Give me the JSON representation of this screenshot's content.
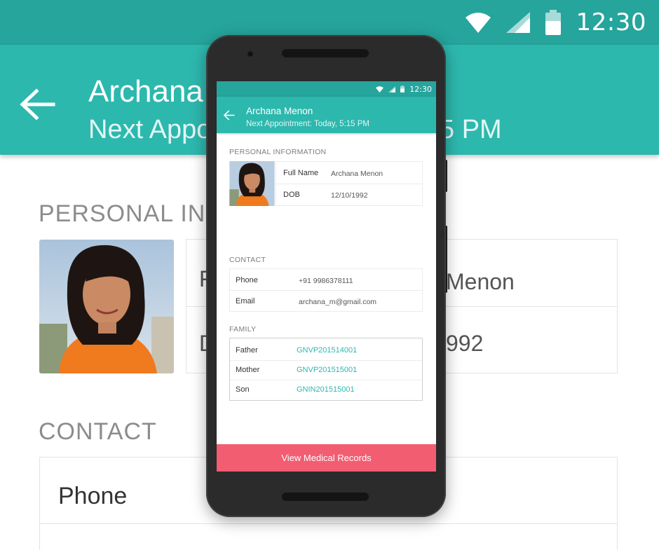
{
  "background": {
    "status_time": "12:30",
    "title_visible": "Archana",
    "subtitle_visible": "Next Appo",
    "subtitle_tail": "5 PM",
    "section_personal": "PERSONAL INFO",
    "card_name_tail": "Menon",
    "card_dob_tail": "992",
    "card_letter_f": "F",
    "card_letter_d": "D",
    "section_contact": "CONTACT",
    "contact_phone_label": "Phone"
  },
  "phone": {
    "status_time": "12:30",
    "title": "Archana Menon",
    "subtitle": "Next Appointment: Today, 5:15 PM",
    "personal": {
      "heading": "PERSONAL INFORMATION",
      "rows": [
        {
          "label": "Full Name",
          "value": "Archana Menon"
        },
        {
          "label": "DOB",
          "value": "12/10/1992"
        }
      ]
    },
    "contact": {
      "heading": "CONTACT",
      "rows": [
        {
          "label": "Phone",
          "value": "+91 9986378111"
        },
        {
          "label": "Email",
          "value": "archana_m@gmail.com"
        }
      ]
    },
    "family": {
      "heading": "FAMILY",
      "rows": [
        {
          "label": "Father",
          "value": "GNVP201514001"
        },
        {
          "label": "Mother",
          "value": "GNVP201515001"
        },
        {
          "label": "Son",
          "value": "GNIN201515001"
        }
      ]
    },
    "cta_label": "View Medical Records"
  },
  "icons": {
    "status": [
      "wifi-icon",
      "signal-icon",
      "battery-icon"
    ],
    "back": "arrow-left-icon"
  },
  "colors": {
    "status_bar": "#26a59c",
    "app_bar": "#2db8ae",
    "link": "#2db8ae",
    "cta": "#f25d72"
  }
}
